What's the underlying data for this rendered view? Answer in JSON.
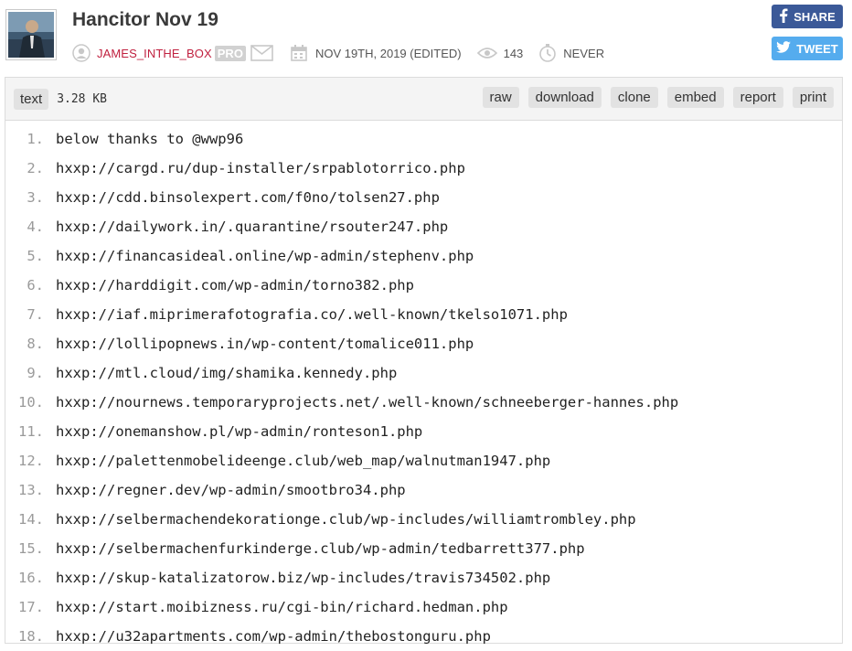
{
  "paste": {
    "title": "Hancitor Nov 19",
    "username": "JAMES_INTHE_BOX",
    "pro_badge": "PRO",
    "date": "NOV 19TH, 2019 (EDITED)",
    "views": "143",
    "expiry": "NEVER"
  },
  "social": {
    "share_label": "SHARE",
    "tweet_label": "TWEET",
    "facebook_color": "#3b5998",
    "twitter_color": "#55acee"
  },
  "toolbar": {
    "syntax": "text",
    "size": "3.28 KB",
    "actions": [
      "raw",
      "download",
      "clone",
      "embed",
      "report",
      "print"
    ]
  },
  "code_lines": [
    {
      "n": "1.",
      "t": "below thanks to @wwp96"
    },
    {
      "n": "2.",
      "t": "hxxp://cargd.ru/dup-installer/srpablotorrico.php"
    },
    {
      "n": "3.",
      "t": "hxxp://cdd.binsolexpert.com/f0no/tolsen27.php"
    },
    {
      "n": "4.",
      "t": "hxxp://dailywork.in/.quarantine/rsouter247.php"
    },
    {
      "n": "5.",
      "t": "hxxp://financasideal.online/wp-admin/stephenv.php"
    },
    {
      "n": "6.",
      "t": "hxxp://harddigit.com/wp-admin/torno382.php"
    },
    {
      "n": "7.",
      "t": "hxxp://iaf.miprimerafotografia.co/.well-known/tkelso1071.php"
    },
    {
      "n": "8.",
      "t": "hxxp://lollipopnews.in/wp-content/tomalice011.php"
    },
    {
      "n": "9.",
      "t": "hxxp://mtl.cloud/img/shamika.kennedy.php"
    },
    {
      "n": "10.",
      "t": "hxxp://nournews.temporaryprojects.net/.well-known/schneeberger-hannes.php"
    },
    {
      "n": "11.",
      "t": "hxxp://onemanshow.pl/wp-admin/ronteson1.php"
    },
    {
      "n": "12.",
      "t": "hxxp://palettenmobelideenge.club/web_map/walnutman1947.php"
    },
    {
      "n": "13.",
      "t": "hxxp://regner.dev/wp-admin/smootbro34.php"
    },
    {
      "n": "14.",
      "t": "hxxp://selbermachendekorationge.club/wp-includes/williamtrombley.php"
    },
    {
      "n": "15.",
      "t": "hxxp://selbermachenfurkinderge.club/wp-admin/tedbarrett377.php"
    },
    {
      "n": "16.",
      "t": "hxxp://skup-katalizatorow.biz/wp-includes/travis734502.php"
    },
    {
      "n": "17.",
      "t": "hxxp://start.moibizness.ru/cgi-bin/richard.hedman.php"
    },
    {
      "n": "18.",
      "t": "hxxp://u32apartments.com/wp-admin/thebostonguru.php"
    }
  ]
}
